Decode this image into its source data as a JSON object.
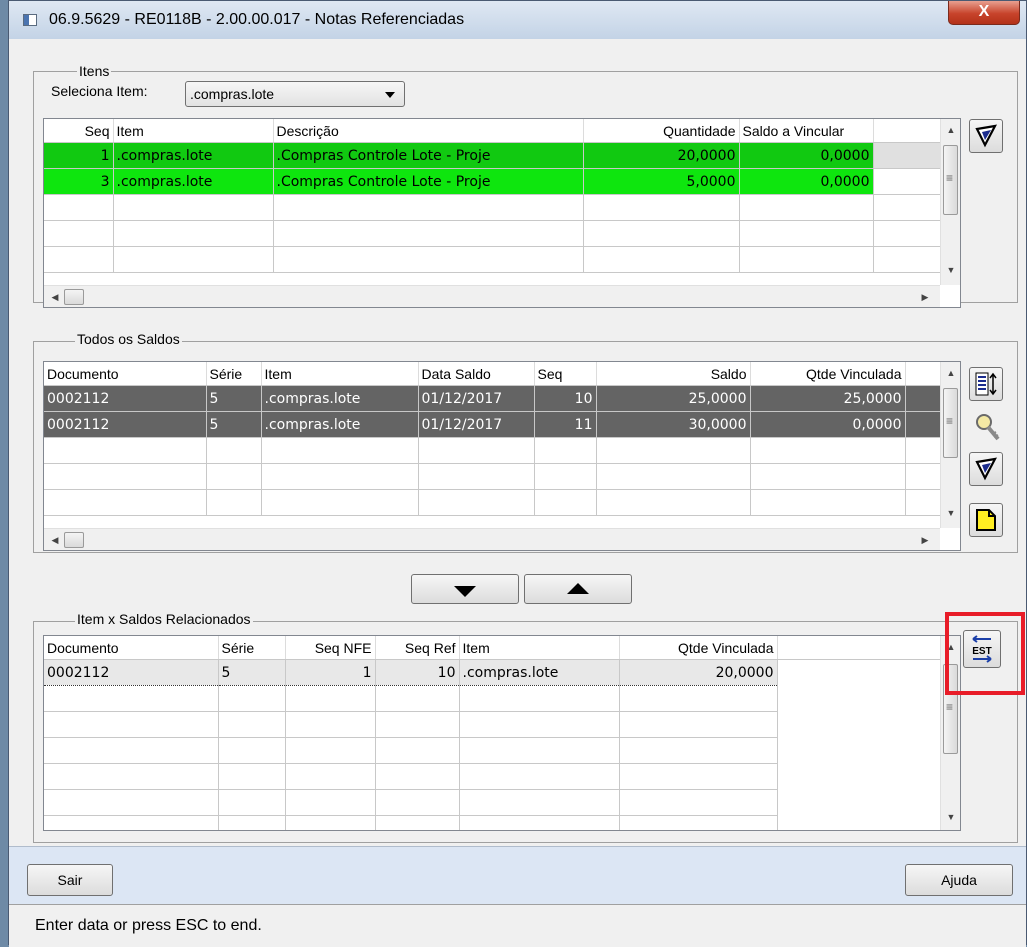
{
  "window": {
    "title": "06.9.5629 - RE0118B - 2.00.00.017 - Notas Referenciadas",
    "close_label": "X"
  },
  "itens": {
    "group_label": "Itens",
    "selector_label": "Seleciona Item:",
    "selector_value": ".compras.lote",
    "columns": [
      "Seq",
      "Item",
      "Descrição",
      "Quantidade",
      "Saldo a Vincular"
    ],
    "rows": [
      [
        "1",
        ".compras.lote",
        ".Compras Controle Lote - Proje",
        "20,0000",
        "0,0000"
      ],
      [
        "3",
        ".compras.lote",
        ".Compras Controle Lote - Proje",
        "5,0000",
        "0,0000"
      ]
    ]
  },
  "saldos": {
    "group_label": "Todos os Saldos",
    "columns": [
      "Documento",
      "Série",
      "Item",
      "Data Saldo",
      "Seq",
      "Saldo",
      "Qtde Vinculada"
    ],
    "rows": [
      [
        "0002112",
        "5",
        ".compras.lote",
        "01/12/2017",
        "10",
        "25,0000",
        "25,0000"
      ],
      [
        "0002112",
        "5",
        ".compras.lote",
        "01/12/2017",
        "11",
        "30,0000",
        "0,0000"
      ]
    ]
  },
  "relacionados": {
    "group_label": "Item x Saldos Relacionados",
    "columns": [
      "Documento",
      "Série",
      "Seq NFE",
      "Seq Ref",
      "Item",
      "Qtde Vinculada"
    ],
    "rows": [
      [
        "0002112",
        "5",
        "1",
        "10",
        ".compras.lote",
        "20,0000"
      ]
    ]
  },
  "buttons": {
    "sair": "Sair",
    "ajuda": "Ajuda",
    "est_icon_text": "EST"
  },
  "status_text": "Enter data or press ESC to end.",
  "colors": {
    "row_green_1": "#11c911",
    "row_green_2": "#0ee60e",
    "row_selected_dark": "#646464",
    "highlight_box": "#e81c28"
  }
}
